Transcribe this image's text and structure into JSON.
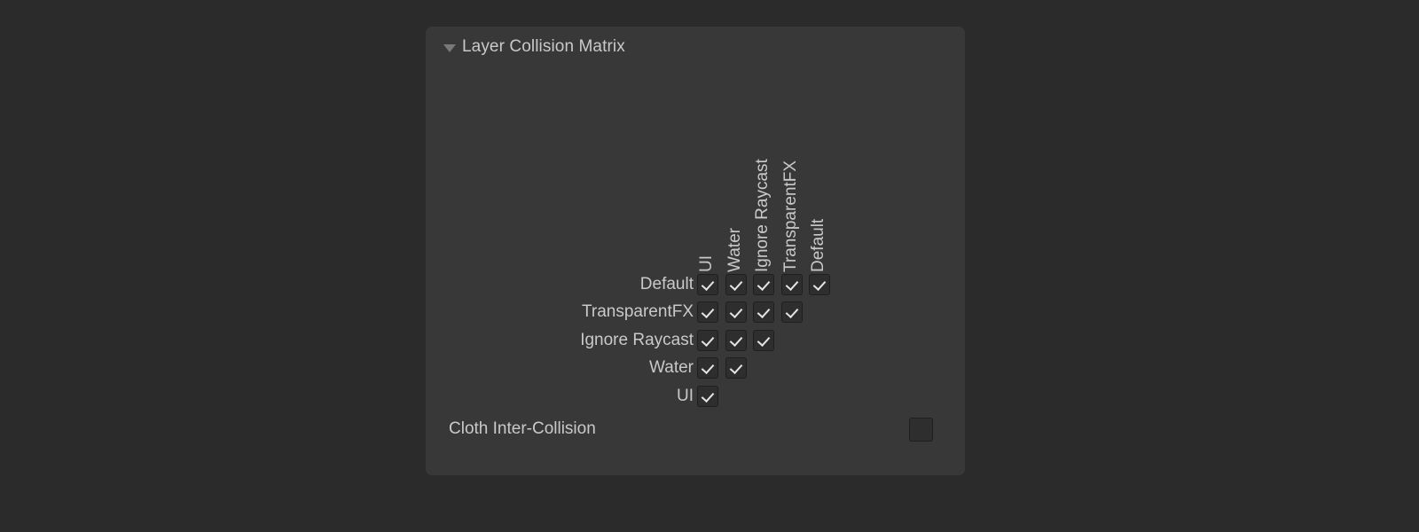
{
  "panel": {
    "title": "Layer Collision Matrix",
    "foldout_icon": "triangle-down-icon",
    "expanded": true,
    "background_color": "#383838",
    "page_background_color": "#2b2b2b",
    "text_color": "#c9c9c9"
  },
  "matrix": {
    "column_headers": [
      "UI",
      "Water",
      "Ignore Raycast",
      "TransparentFX",
      "Default"
    ],
    "rows": [
      {
        "label": "Default",
        "cells": [
          true,
          true,
          true,
          true,
          true
        ]
      },
      {
        "label": "TransparentFX",
        "cells": [
          true,
          true,
          true,
          true
        ]
      },
      {
        "label": "Ignore Raycast",
        "cells": [
          true,
          true,
          true
        ]
      },
      {
        "label": "Water",
        "cells": [
          true,
          true
        ]
      },
      {
        "label": "UI",
        "cells": [
          true
        ]
      }
    ]
  },
  "cloth": {
    "label": "Cloth Inter-Collision",
    "checked": false
  }
}
